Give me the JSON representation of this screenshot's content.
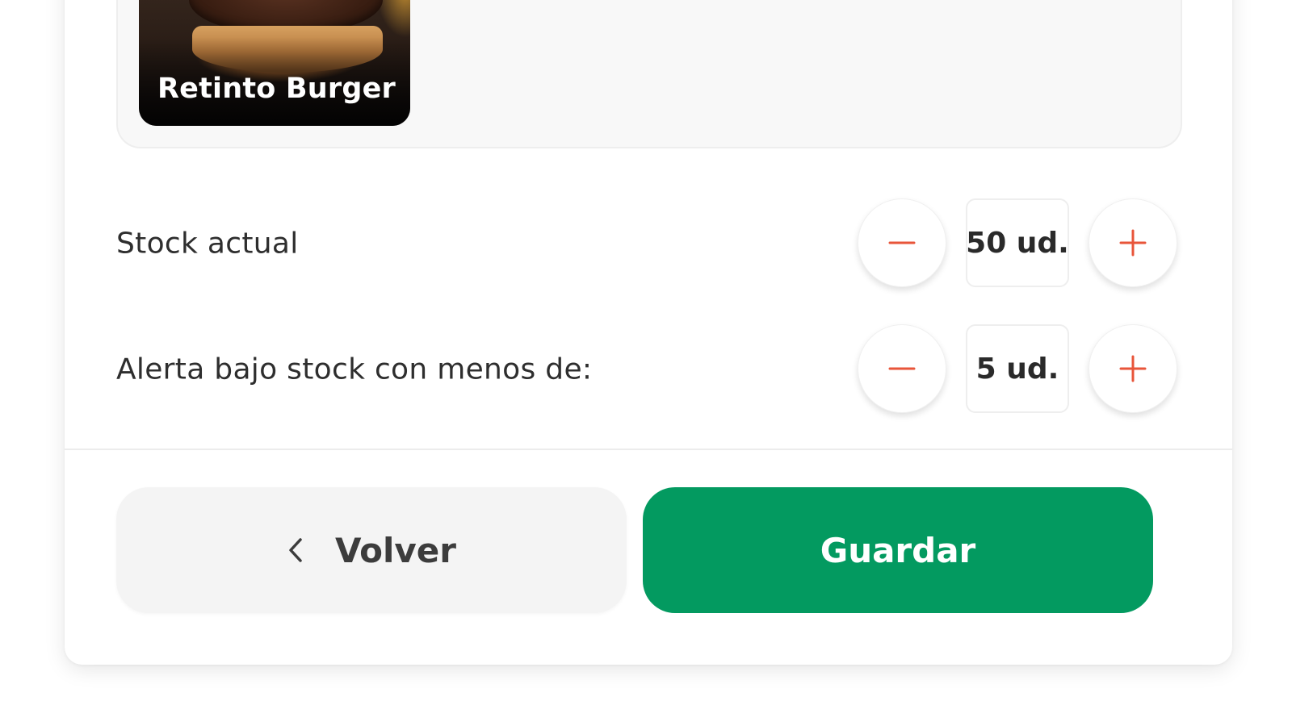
{
  "product": {
    "name": "Retinto Burger"
  },
  "stock": {
    "label": "Stock actual",
    "value": "50 ud."
  },
  "alert": {
    "label": "Alerta bajo stock con menos de:",
    "value": "5 ud."
  },
  "actions": {
    "back_label": "Volver",
    "save_label": "Guardar"
  },
  "icons": {
    "minus": "minus-icon",
    "plus": "plus-icon",
    "back": "chevron-left-icon"
  },
  "colors": {
    "accent_green": "#039a60",
    "stepper_icon": "#e8553a",
    "back_button_bg": "#f4f4f4"
  }
}
